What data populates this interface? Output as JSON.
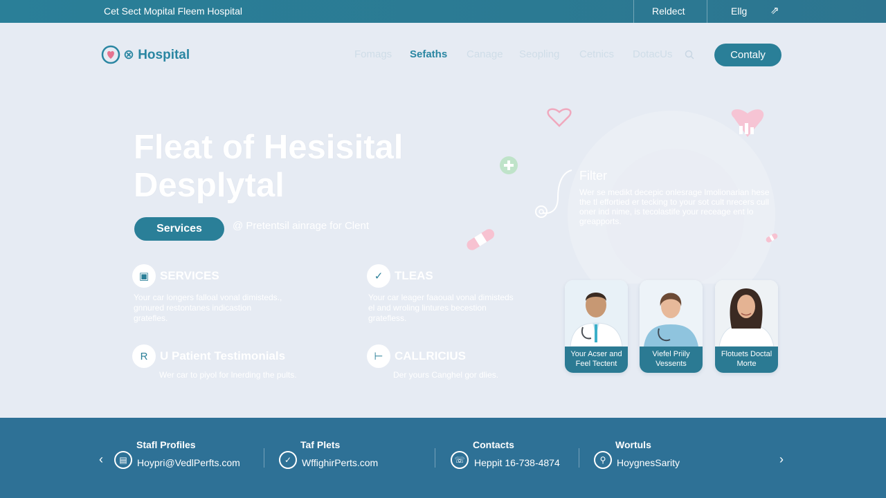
{
  "topbar": {
    "title": "Cet Sect Mopital Fleem Hospital",
    "item1": "Reldect",
    "item2": "Ellg",
    "arrow": "⇗"
  },
  "header": {
    "logo_text": "⊗ Hospital",
    "nav": [
      "Fomags",
      "Sefaths",
      "Canage",
      "Seopling",
      "Cetnics",
      "DotacUs"
    ],
    "cta": "Contaly"
  },
  "hero": {
    "title_line1": "Fleat of Hesisital",
    "title_line2": "Desplytal",
    "button": "Services",
    "subtitle": "@ Pretentsil ainrage for Clent"
  },
  "features": [
    {
      "icon": "▣",
      "title": "SERVICES",
      "text": "Your car longers falloal vonal dimisteds., gnnured restontanes indicastion gratefles."
    },
    {
      "icon": "✓",
      "title": "TLEAS",
      "text": "Your car leager faaoual vonal dimisteds el and wroling lintures becestion gratefless."
    },
    {
      "icon": "R",
      "title": "U Patient Testimonials",
      "text": "Wer car to piyol for lnerding the pults."
    },
    {
      "icon": "⊢",
      "title": "CALLRICIUS",
      "text": "Der yours Canghel gor dlies."
    }
  ],
  "filter": {
    "title": "Filter",
    "text": "Wer se medikt decepic onlesrage lmolionarian hese the tl effortied er tecking to your sot cult nrecers cull oner ind nime, is tecolastife your receage ent lo greapports."
  },
  "doctors": [
    {
      "label1": "Your Acser and",
      "label2": "Feel Tectent"
    },
    {
      "label1": "Viefel Priily",
      "label2": "Vessents"
    },
    {
      "label1": "Flotuets Doctal",
      "label2": "Morte"
    }
  ],
  "footer": {
    "columns": [
      {
        "title": "Stafl Profiles",
        "icon": "▤",
        "text": "Hoypri@VedlPerfts.com"
      },
      {
        "title": "Taf Plets",
        "icon": "✓",
        "text": "WffighirPerts.com"
      },
      {
        "title": "Contacts",
        "icon": "☏",
        "text": "Heppit 16-738-4874"
      },
      {
        "title": "Wortuls",
        "icon": "⚲",
        "text": "HoygnesSarity"
      }
    ],
    "prev": "‹",
    "next": "›"
  },
  "colors": {
    "primary": "#2a7f98",
    "background": "#e6ebf3",
    "footer": "#2e7196"
  }
}
